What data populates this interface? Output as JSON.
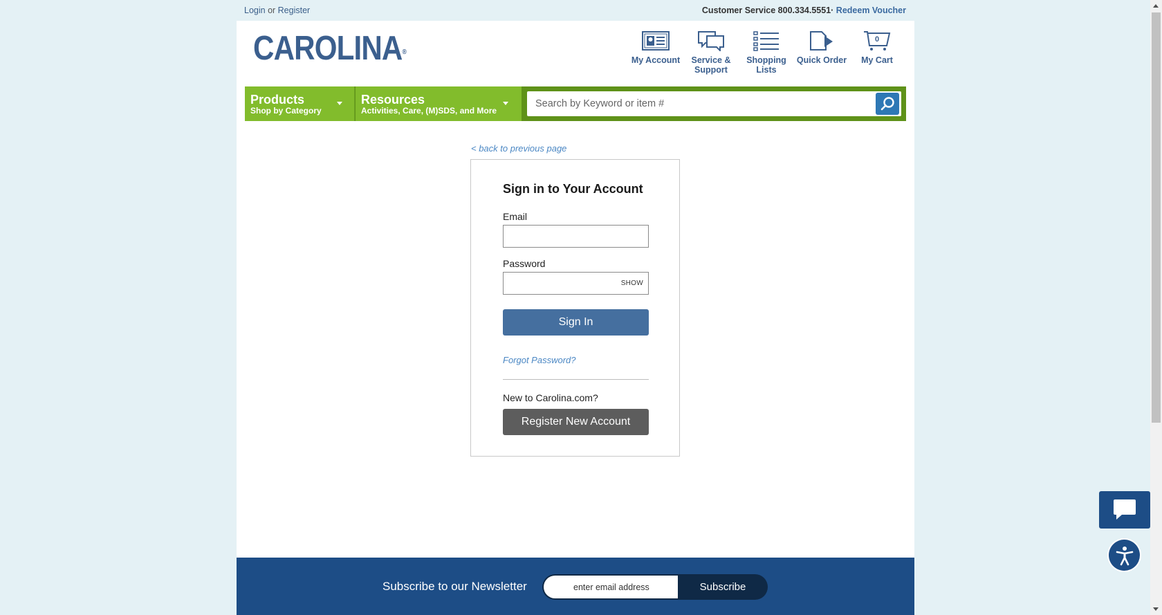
{
  "utility_bar": {
    "login_label": "Login",
    "or_text": " or ",
    "register_label": "Register",
    "customer_service": "Customer Service 800.334.5551",
    "separator": "· ",
    "redeem_voucher": "Redeem Voucher"
  },
  "header": {
    "logo_text": "CAROLINA",
    "logo_mark": "®",
    "icons": [
      {
        "label": "My Account",
        "icon": "account-card-icon"
      },
      {
        "label": "Service & Support",
        "icon": "chat-bubbles-icon"
      },
      {
        "label": "Shopping Lists",
        "icon": "list-icon"
      },
      {
        "label": "Quick Order",
        "icon": "quick-order-icon"
      },
      {
        "label": "My Cart",
        "icon": "cart-icon",
        "count": "0"
      }
    ]
  },
  "nav": {
    "products_title": "Products",
    "products_sub": "Shop by Category",
    "resources_title": "Resources",
    "resources_sub": "Activities, Care, (M)SDS, and More",
    "search_placeholder": "Search by Keyword or item #"
  },
  "back_link": "< back to previous page",
  "signin": {
    "title": "Sign in to Your Account",
    "email_label": "Email",
    "email_value": "",
    "password_label": "Password",
    "password_value": "",
    "show_label": "SHOW",
    "signin_button": "Sign In",
    "forgot_password": "Forgot Password?",
    "new_to": "New to Carolina.com?",
    "register_button": "Register New Account"
  },
  "newsletter": {
    "title": "Subscribe to our Newsletter",
    "placeholder": "enter email address",
    "button": "Subscribe"
  },
  "colors": {
    "brand_blue": "#3b5f8e",
    "nav_green": "#82bc2c",
    "footer_blue": "#1d4d86",
    "signin_button": "#456f9f",
    "register_button": "#5d5d5d"
  }
}
